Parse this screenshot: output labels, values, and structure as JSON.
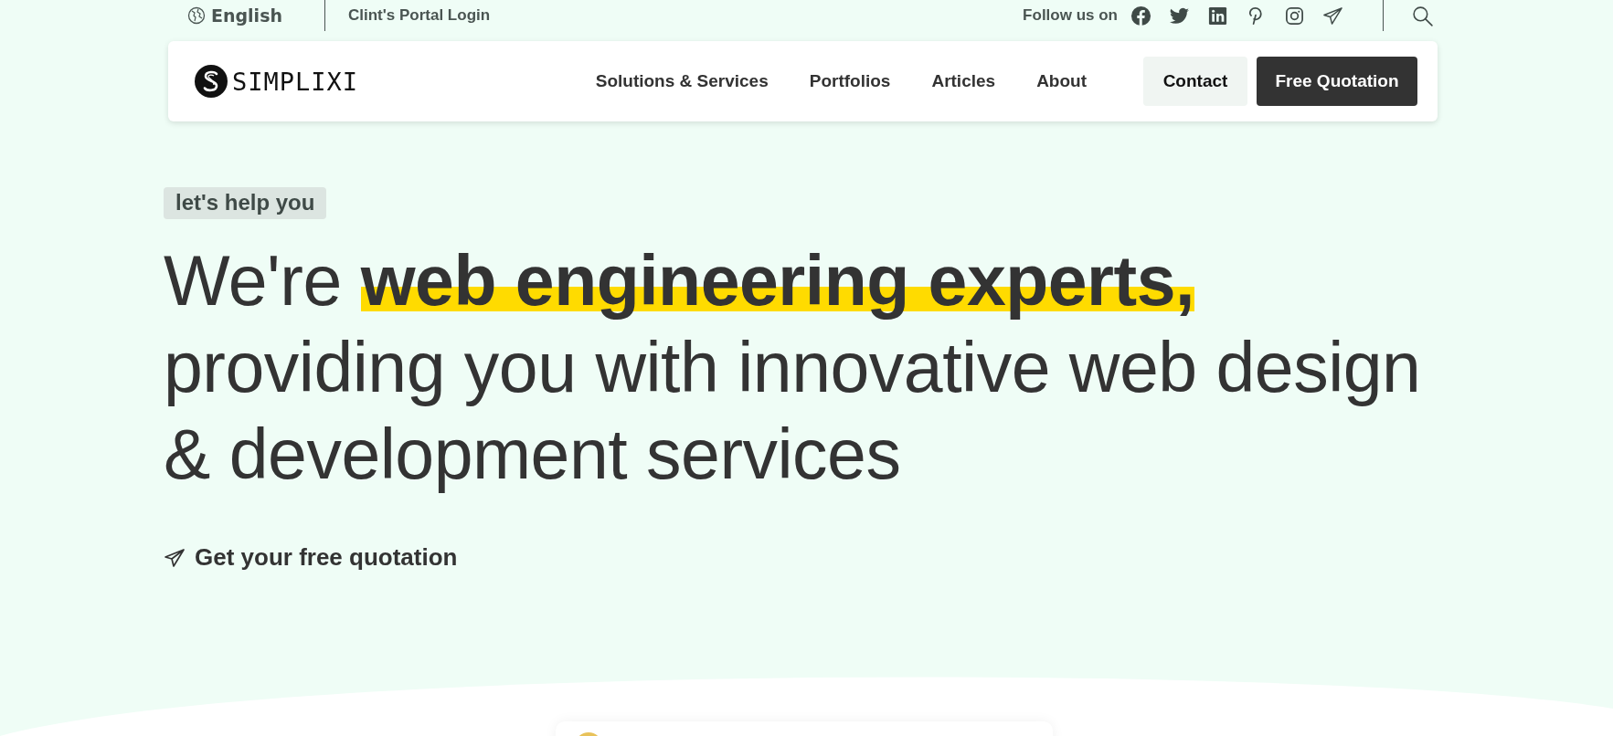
{
  "top_bar": {
    "language": "English",
    "portal_link": "Clint's Portal Login",
    "follow_label": "Follow us on",
    "social": [
      {
        "kind": "facebook"
      },
      {
        "kind": "twitter"
      },
      {
        "kind": "linkedin"
      },
      {
        "kind": "pinterest"
      },
      {
        "kind": "instagram"
      },
      {
        "kind": "telegram"
      }
    ]
  },
  "nav": {
    "logo": "SIMPLIXI",
    "items": [
      "Solutions & Services",
      "Portfolios",
      "Articles",
      "About"
    ],
    "buttons": [
      {
        "label": "Contact",
        "kind": "secondary"
      },
      {
        "label": "Free Quotation",
        "kind": "primary"
      }
    ]
  },
  "hero": {
    "badge": "let's help you",
    "headline": "We're **web engineering experts,** providing you with innovative web design & development services",
    "cta": "Get your free quotation"
  }
}
